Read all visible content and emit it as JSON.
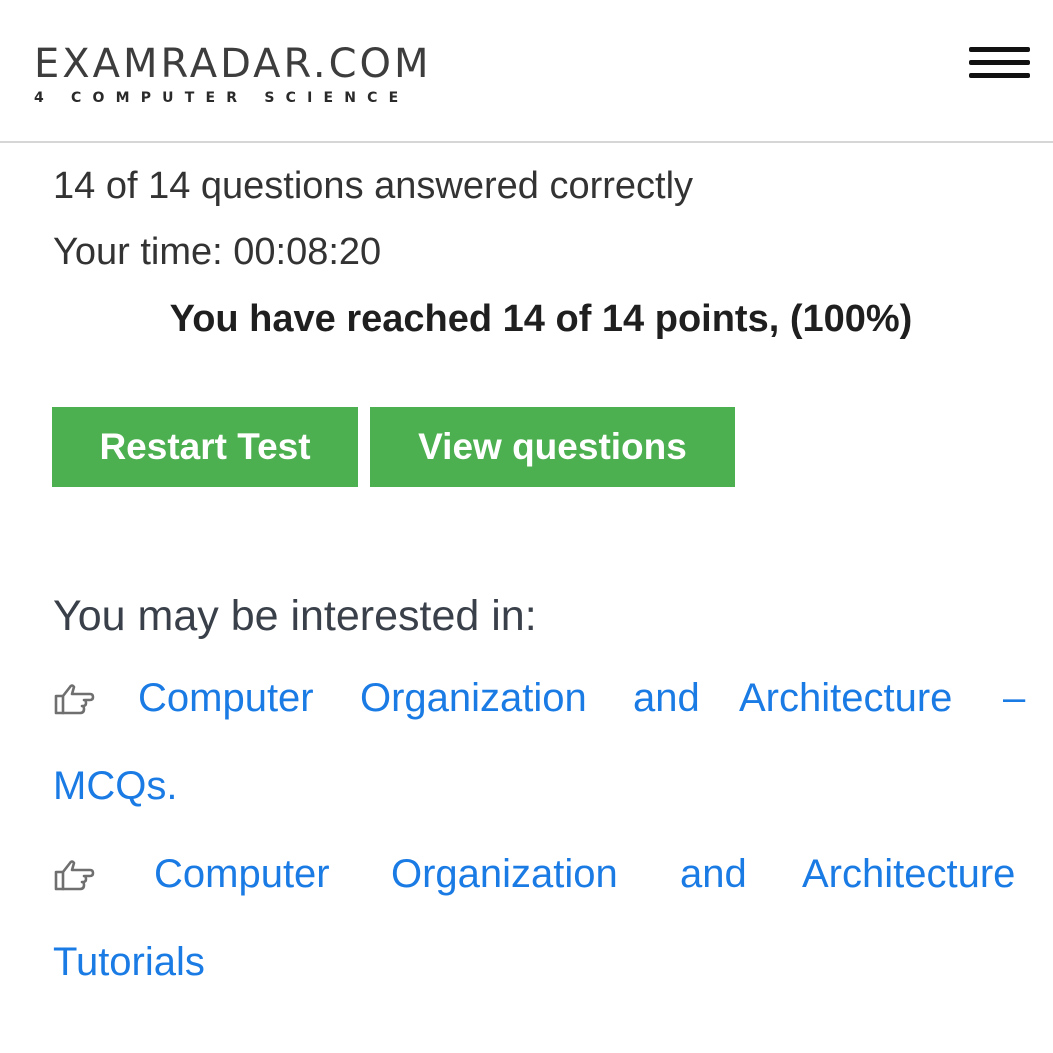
{
  "header": {
    "logo_main": "EXAMRADAR.COM",
    "logo_sub": "4 COMPUTER SCIENCE",
    "menu_icon": "hamburger-menu-icon"
  },
  "results": {
    "answered": "14 of 14 questions answered correctly",
    "time": "Your time: 00:08:20",
    "points": "You have reached 14 of 14 points, (100%)"
  },
  "buttons": {
    "restart": "Restart Test",
    "view": "View questions"
  },
  "colors": {
    "button_green": "#4cb050",
    "link_blue": "#1a7be5",
    "icon_gray": "#6f6f6f"
  },
  "related": {
    "title": "You may be interested in:",
    "bullet_icon": "pointing-hand-icon",
    "links": [
      {
        "words": [
          "Computer",
          "Organization",
          "and",
          "Architecture",
          "–"
        ],
        "continuation": "MCQs."
      },
      {
        "words": [
          "Computer",
          "Organization",
          "and",
          "Architecture"
        ],
        "continuation": "Tutorials"
      }
    ]
  }
}
